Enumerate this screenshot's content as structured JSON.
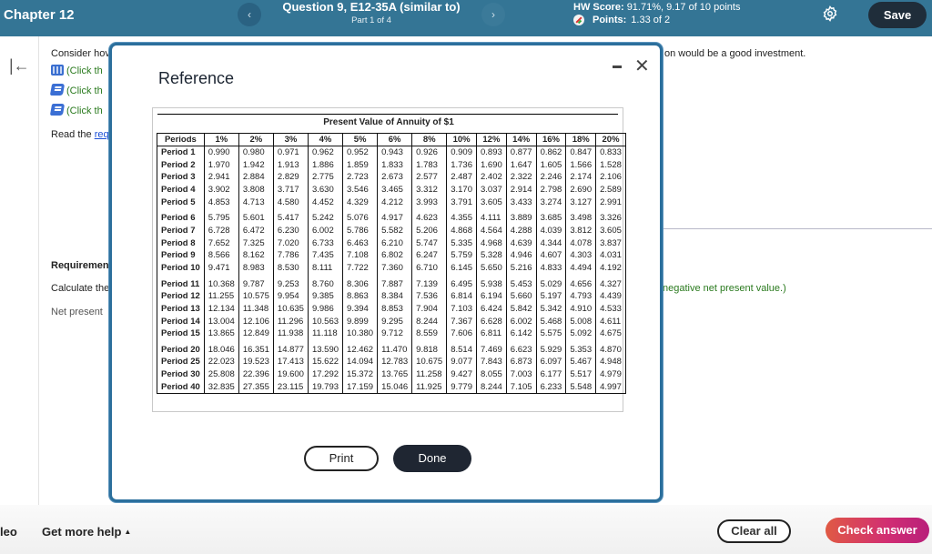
{
  "header": {
    "chapter": "Chapter 12",
    "question_title": "Question 9, E12-35A (similar to)",
    "question_part": "Part 1 of 4",
    "hw_score_label": "HW Score:",
    "hw_score_value": "91.71%, 9.17 of 10 points",
    "points_label": "Points:",
    "points_value": "1.33 of 2",
    "save_label": "Save",
    "prev_icon": "‹",
    "next_icon": "›"
  },
  "background": {
    "consider_text": "Consider hov",
    "click_links": [
      "(Click th",
      "(Click th",
      "(Click th"
    ],
    "read_prefix": "Read the ",
    "read_link": "req",
    "requirements_heading": "Requiremen",
    "calculate_text": "Calculate the",
    "net_present_text": "Net present",
    "right_text_top": "on would be a good investment.",
    "right_text_mid": "negative net present value.)"
  },
  "modal": {
    "title": "Reference",
    "close_icon": "✕",
    "print_label": "Print",
    "done_label": "Done",
    "table": {
      "caption": "Present Value of Annuity of $1",
      "headers": [
        "Periods",
        "1%",
        "2%",
        "3%",
        "4%",
        "5%",
        "6%",
        "8%",
        "10%",
        "12%",
        "14%",
        "16%",
        "18%",
        "20%"
      ],
      "rows": [
        {
          "period": "Period 1",
          "values": [
            "0.990",
            "0.980",
            "0.971",
            "0.962",
            "0.952",
            "0.943",
            "0.926",
            "0.909",
            "0.893",
            "0.877",
            "0.862",
            "0.847",
            "0.833"
          ]
        },
        {
          "period": "Period 2",
          "values": [
            "1.970",
            "1.942",
            "1.913",
            "1.886",
            "1.859",
            "1.833",
            "1.783",
            "1.736",
            "1.690",
            "1.647",
            "1.605",
            "1.566",
            "1.528"
          ]
        },
        {
          "period": "Period 3",
          "values": [
            "2.941",
            "2.884",
            "2.829",
            "2.775",
            "2.723",
            "2.673",
            "2.577",
            "2.487",
            "2.402",
            "2.322",
            "2.246",
            "2.174",
            "2.106"
          ]
        },
        {
          "period": "Period 4",
          "values": [
            "3.902",
            "3.808",
            "3.717",
            "3.630",
            "3.546",
            "3.465",
            "3.312",
            "3.170",
            "3.037",
            "2.914",
            "2.798",
            "2.690",
            "2.589"
          ]
        },
        {
          "period": "Period 5",
          "values": [
            "4.853",
            "4.713",
            "4.580",
            "4.452",
            "4.329",
            "4.212",
            "3.993",
            "3.791",
            "3.605",
            "3.433",
            "3.274",
            "3.127",
            "2.991"
          ]
        },
        {
          "period": "Period 6",
          "values": [
            "5.795",
            "5.601",
            "5.417",
            "5.242",
            "5.076",
            "4.917",
            "4.623",
            "4.355",
            "4.111",
            "3.889",
            "3.685",
            "3.498",
            "3.326"
          ]
        },
        {
          "period": "Period 7",
          "values": [
            "6.728",
            "6.472",
            "6.230",
            "6.002",
            "5.786",
            "5.582",
            "5.206",
            "4.868",
            "4.564",
            "4.288",
            "4.039",
            "3.812",
            "3.605"
          ]
        },
        {
          "period": "Period 8",
          "values": [
            "7.652",
            "7.325",
            "7.020",
            "6.733",
            "6.463",
            "6.210",
            "5.747",
            "5.335",
            "4.968",
            "4.639",
            "4.344",
            "4.078",
            "3.837"
          ]
        },
        {
          "period": "Period 9",
          "values": [
            "8.566",
            "8.162",
            "7.786",
            "7.435",
            "7.108",
            "6.802",
            "6.247",
            "5.759",
            "5.328",
            "4.946",
            "4.607",
            "4.303",
            "4.031"
          ]
        },
        {
          "period": "Period 10",
          "values": [
            "9.471",
            "8.983",
            "8.530",
            "8.111",
            "7.722",
            "7.360",
            "6.710",
            "6.145",
            "5.650",
            "5.216",
            "4.833",
            "4.494",
            "4.192"
          ]
        },
        {
          "period": "Period 11",
          "values": [
            "10.368",
            "9.787",
            "9.253",
            "8.760",
            "8.306",
            "7.887",
            "7.139",
            "6.495",
            "5.938",
            "5.453",
            "5.029",
            "4.656",
            "4.327"
          ]
        },
        {
          "period": "Period 12",
          "values": [
            "11.255",
            "10.575",
            "9.954",
            "9.385",
            "8.863",
            "8.384",
            "7.536",
            "6.814",
            "6.194",
            "5.660",
            "5.197",
            "4.793",
            "4.439"
          ]
        },
        {
          "period": "Period 13",
          "values": [
            "12.134",
            "11.348",
            "10.635",
            "9.986",
            "9.394",
            "8.853",
            "7.904",
            "7.103",
            "6.424",
            "5.842",
            "5.342",
            "4.910",
            "4.533"
          ]
        },
        {
          "period": "Period 14",
          "values": [
            "13.004",
            "12.106",
            "11.296",
            "10.563",
            "9.899",
            "9.295",
            "8.244",
            "7.367",
            "6.628",
            "6.002",
            "5.468",
            "5.008",
            "4.611"
          ]
        },
        {
          "period": "Period 15",
          "values": [
            "13.865",
            "12.849",
            "11.938",
            "11.118",
            "10.380",
            "9.712",
            "8.559",
            "7.606",
            "6.811",
            "6.142",
            "5.575",
            "5.092",
            "4.675"
          ]
        },
        {
          "period": "Period 20",
          "values": [
            "18.046",
            "16.351",
            "14.877",
            "13.590",
            "12.462",
            "11.470",
            "9.818",
            "8.514",
            "7.469",
            "6.623",
            "5.929",
            "5.353",
            "4.870"
          ]
        },
        {
          "period": "Period 25",
          "values": [
            "22.023",
            "19.523",
            "17.413",
            "15.622",
            "14.094",
            "12.783",
            "10.675",
            "9.077",
            "7.843",
            "6.873",
            "6.097",
            "5.467",
            "4.948"
          ]
        },
        {
          "period": "Period 30",
          "values": [
            "25.808",
            "22.396",
            "19.600",
            "17.292",
            "15.372",
            "13.765",
            "11.258",
            "9.427",
            "8.055",
            "7.003",
            "6.177",
            "5.517",
            "4.979"
          ]
        },
        {
          "period": "Period 40",
          "values": [
            "32.835",
            "27.355",
            "23.115",
            "19.793",
            "17.159",
            "15.046",
            "11.925",
            "9.779",
            "8.244",
            "7.105",
            "6.233",
            "5.548",
            "4.997"
          ]
        }
      ]
    }
  },
  "footer": {
    "video_label": "leo",
    "help_label": "Get more help",
    "help_caret": "▲",
    "clear_label": "Clear all",
    "check_label": "Check answer"
  }
}
